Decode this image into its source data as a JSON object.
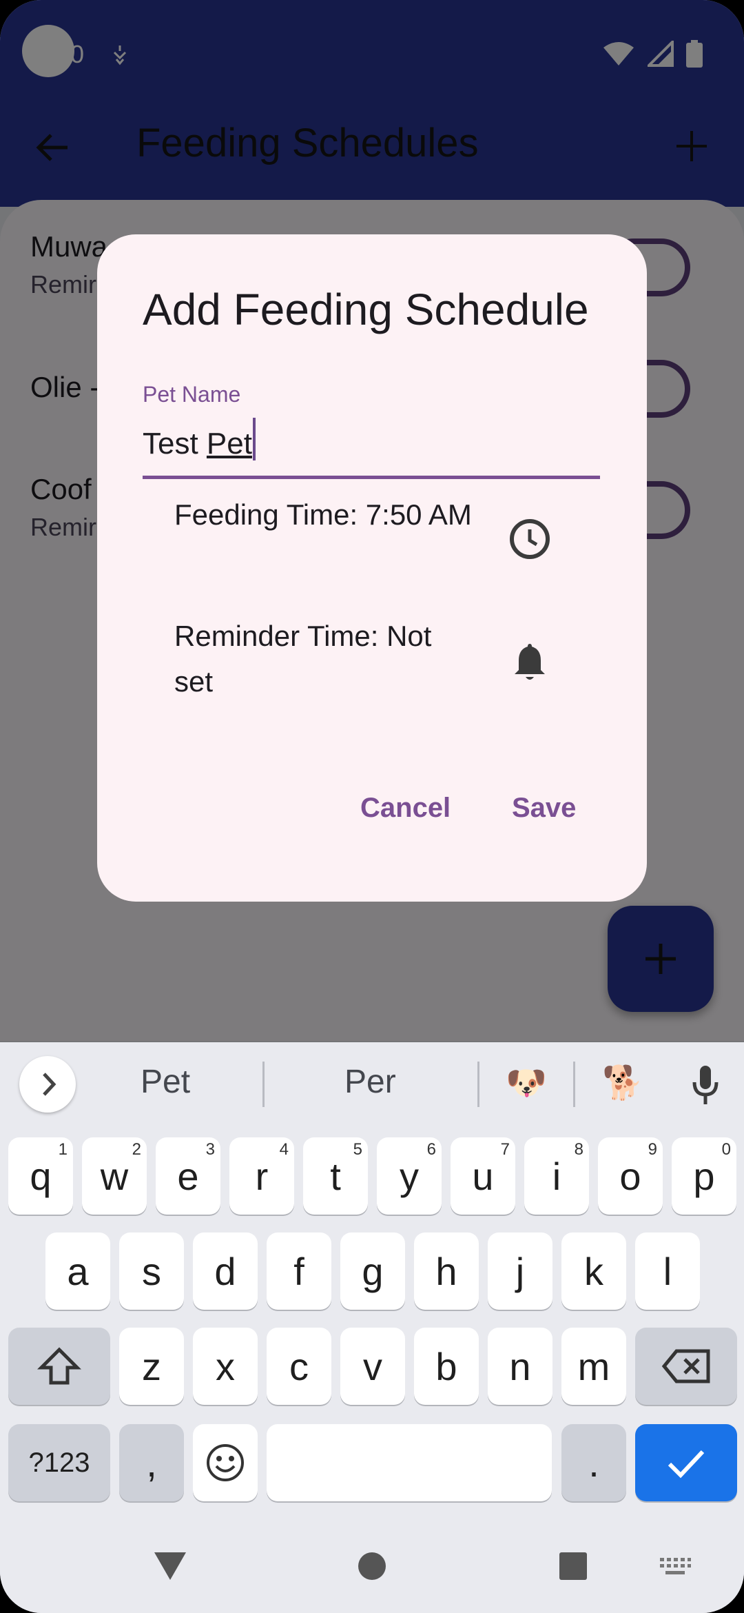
{
  "status_bar": {
    "time_fragment": "0"
  },
  "app_bar": {
    "title": "Feeding Schedules"
  },
  "list": {
    "items": [
      {
        "name": "Muwa",
        "sub": "Remir"
      },
      {
        "name": "Olie -",
        "sub": ""
      },
      {
        "name": "Coof",
        "sub": "Remir"
      }
    ]
  },
  "dialog": {
    "title": "Add Feeding Schedule",
    "field_label": "Pet Name",
    "field_value_1": "Test ",
    "field_value_2": "Pet",
    "feeding_time": "Feeding Time: 7:50 AM",
    "reminder_time": "Reminder Time: Not set",
    "cancel": "Cancel",
    "save": "Save"
  },
  "keyboard": {
    "suggestions": [
      "Pet",
      "Per"
    ],
    "emoji_suggestions": [
      "🐶",
      "🐕"
    ],
    "row1": [
      [
        "q",
        "1"
      ],
      [
        "w",
        "2"
      ],
      [
        "e",
        "3"
      ],
      [
        "r",
        "4"
      ],
      [
        "t",
        "5"
      ],
      [
        "y",
        "6"
      ],
      [
        "u",
        "7"
      ],
      [
        "i",
        "8"
      ],
      [
        "o",
        "9"
      ],
      [
        "p",
        "0"
      ]
    ],
    "row2": [
      "a",
      "s",
      "d",
      "f",
      "g",
      "h",
      "j",
      "k",
      "l"
    ],
    "row3": [
      "z",
      "x",
      "c",
      "v",
      "b",
      "n",
      "m"
    ],
    "symbols_key": "?123",
    "comma_key": ",",
    "period_key": "."
  },
  "colors": {
    "app_bar": "#283593",
    "dialog": "#fdf2f5",
    "accent": "#7a4f93",
    "enter_key": "#1a73e8"
  },
  "icons": [
    "back-arrow-icon",
    "add-icon",
    "clock-icon",
    "bell-icon",
    "chevron-right-icon",
    "mic-icon",
    "shift-icon",
    "backspace-icon",
    "emoji-icon",
    "check-icon"
  ]
}
